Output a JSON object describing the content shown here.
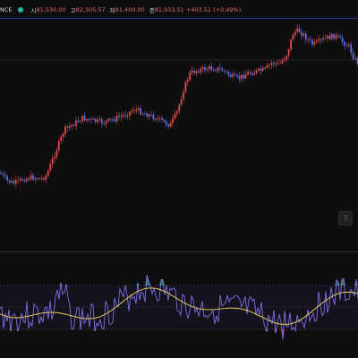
{
  "legend": {
    "ticker_fragment": "NCE",
    "open_label": "시",
    "open_value": "81,530.00",
    "high_label": "고",
    "high_value": "82,305.57",
    "low_label": "저",
    "low_value": "81,400.00",
    "close_label": "종",
    "close_value": "81,933.51",
    "change": "+403.51 (+0.49%)"
  },
  "colors": {
    "background": "#0e0e0e",
    "up": "#e04b4b",
    "down": "#5b6fe0",
    "indicator_line": "#7f6ee6",
    "indicator_signal": "#e6c75a",
    "overbought_fill": "#2e8b57",
    "oversold_fill": "#c23b3b",
    "level_lines": "#4a4a8a"
  },
  "icons": {
    "status_dot": "live-dot-icon",
    "drag_handle": "drag-handle-icon",
    "draw_tool": "pencil-icon"
  }
}
